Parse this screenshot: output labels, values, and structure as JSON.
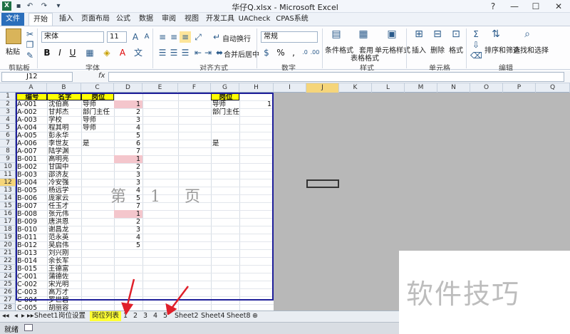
{
  "window": {
    "title": "华仔Q.xlsx - Microsoft Excel",
    "controls": [
      "?",
      "—",
      "☐",
      "✕"
    ]
  },
  "tabs": [
    "文件",
    "开始",
    "插入",
    "页面布局",
    "公式",
    "数据",
    "审阅",
    "视图",
    "开发工具",
    "UACheck",
    "CPAS系统"
  ],
  "ribbon": {
    "paste": "粘贴",
    "font_name": "宋体",
    "font_size": "11",
    "number_format": "常规",
    "wrap_text": "自动换行",
    "merge_center": "合并后居中",
    "cond_format": "条件格式",
    "table_format_1": "套用",
    "table_format_2": "表格格式",
    "cell_style": "单元格样式",
    "insert": "插入",
    "delete": "删除",
    "format": "格式",
    "sort_filter": "排序和筛选",
    "find_select": "查找和选择",
    "bold": "B",
    "italic": "I",
    "underline": "U",
    "percent": "%",
    "comma": ","
  },
  "groups": {
    "clipboard": "剪贴板",
    "font": "字体",
    "alignment": "对齐方式",
    "number": "数字",
    "styles": "样式",
    "cells": "单元格",
    "editing": "编辑"
  },
  "formula_bar": {
    "name_box": "J12",
    "fx": "fx"
  },
  "columns": [
    "A",
    "B",
    "C",
    "D",
    "E",
    "F",
    "G",
    "H",
    "I",
    "J",
    "K",
    "L",
    "M",
    "N",
    "O",
    "P",
    "Q"
  ],
  "rows": [
    "1",
    "2",
    "3",
    "4",
    "5",
    "6",
    "7",
    "8",
    "9",
    "10",
    "11",
    "12",
    "13",
    "14",
    "15",
    "16",
    "17",
    "18",
    "19",
    "20",
    "21",
    "22",
    "23",
    "24",
    "25",
    "26",
    "27",
    "28"
  ],
  "headers": {
    "a": "编号",
    "b": "名字",
    "c": "岗位",
    "g": "岗位"
  },
  "table": [
    {
      "a": "A-001",
      "b": "沈伯高",
      "c": "导师",
      "d": "1",
      "g": "导师",
      "h": "1"
    },
    {
      "a": "A-002",
      "b": "甘邦杰",
      "c": "部门主任",
      "d": "2",
      "g": "部门主任",
      "h": ""
    },
    {
      "a": "A-003",
      "b": "学校",
      "c": "导师",
      "d": "3",
      "g": "",
      "h": ""
    },
    {
      "a": "A-004",
      "b": "程其明",
      "c": "导师",
      "d": "4",
      "g": "",
      "h": ""
    },
    {
      "a": "A-005",
      "b": "彭永华",
      "c": "",
      "d": "5",
      "g": "",
      "h": ""
    },
    {
      "a": "A-006",
      "b": "李世友",
      "c": "是",
      "d": "6",
      "g": "是",
      "h": ""
    },
    {
      "a": "A-007",
      "b": "陆学渊",
      "c": "",
      "d": "7",
      "g": "",
      "h": ""
    },
    {
      "a": "B-001",
      "b": "高明亮",
      "c": "",
      "d": "1",
      "g": "",
      "h": ""
    },
    {
      "a": "B-002",
      "b": "甘国中",
      "c": "",
      "d": "2",
      "g": "",
      "h": ""
    },
    {
      "a": "B-003",
      "b": "邵济友",
      "c": "",
      "d": "3",
      "g": "",
      "h": ""
    },
    {
      "a": "B-004",
      "b": "冷安强",
      "c": "",
      "d": "3",
      "g": "",
      "h": ""
    },
    {
      "a": "B-005",
      "b": "杨远学",
      "c": "",
      "d": "4",
      "g": "",
      "h": ""
    },
    {
      "a": "B-006",
      "b": "庞家云",
      "c": "",
      "d": "5",
      "g": "",
      "h": ""
    },
    {
      "a": "B-007",
      "b": "任玉才",
      "c": "",
      "d": "7",
      "g": "",
      "h": ""
    },
    {
      "a": "B-008",
      "b": "张元伟",
      "c": "",
      "d": "1",
      "g": "",
      "h": ""
    },
    {
      "a": "B-009",
      "b": "唐洪恩",
      "c": "",
      "d": "2",
      "g": "",
      "h": ""
    },
    {
      "a": "B-010",
      "b": "谢昌龙",
      "c": "",
      "d": "3",
      "g": "",
      "h": ""
    },
    {
      "a": "B-011",
      "b": "范永英",
      "c": "",
      "d": "4",
      "g": "",
      "h": ""
    },
    {
      "a": "B-012",
      "b": "吴启伟",
      "c": "",
      "d": "5",
      "g": "",
      "h": ""
    },
    {
      "a": "B-013",
      "b": "刘兴刚",
      "c": "",
      "d": "",
      "g": "",
      "h": ""
    },
    {
      "a": "B-014",
      "b": "余长军",
      "c": "",
      "d": "",
      "g": "",
      "h": ""
    },
    {
      "a": "B-015",
      "b": "王德富",
      "c": "",
      "d": "",
      "g": "",
      "h": ""
    },
    {
      "a": "C-001",
      "b": "蒲德佐",
      "c": "",
      "d": "",
      "g": "",
      "h": ""
    },
    {
      "a": "C-002",
      "b": "宋光明",
      "c": "",
      "d": "",
      "g": "",
      "h": ""
    },
    {
      "a": "C-003",
      "b": "高万才",
      "c": "",
      "d": "",
      "g": "",
      "h": ""
    },
    {
      "a": "C-004",
      "b": "罗世碧",
      "c": "",
      "d": "",
      "g": "",
      "h": ""
    },
    {
      "a": "C-005",
      "b": "胡丽容",
      "c": "",
      "d": "",
      "g": "",
      "h": ""
    }
  ],
  "page_watermark": "第1页",
  "sheets": [
    "Sheet1",
    "岗位设置",
    "岗位列表",
    "1",
    "2",
    "3",
    "4",
    "5",
    "Sheet2",
    "Sheet4",
    "Sheet8"
  ],
  "active_sheet": "岗位列表",
  "status": "就绪",
  "brand": "软件技巧",
  "colors": {
    "header_yellow": "#ffff00",
    "highlight_pink": "#f4c6cc",
    "print_area": "#1f1f9a",
    "arrow": "#e0202a",
    "file_tab": "#2a6ebb"
  }
}
